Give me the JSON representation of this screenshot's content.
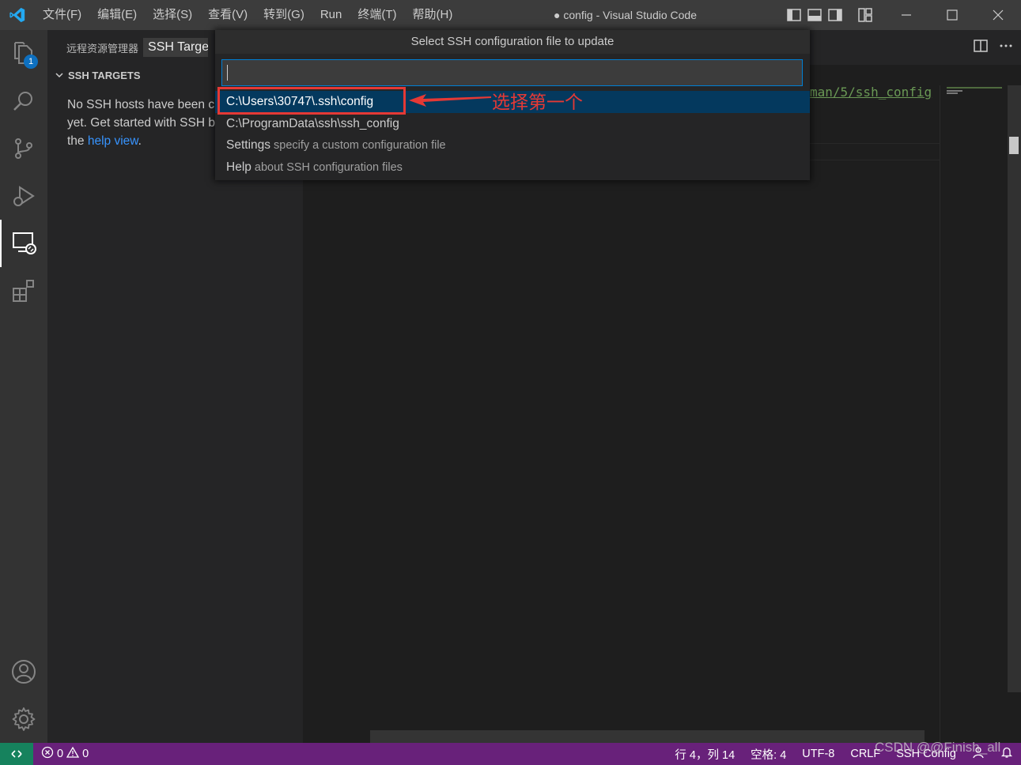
{
  "titlebar": {
    "menu": [
      "文件(F)",
      "编辑(E)",
      "选择(S)",
      "查看(V)",
      "转到(G)",
      "Run",
      "终端(T)",
      "帮助(H)"
    ],
    "window_title": "● config - Visual Studio Code"
  },
  "activitybar": {
    "explorer_badge": "1"
  },
  "sidebar": {
    "title": "远程资源管理器",
    "target_select": "SSH Targets",
    "section_title": "SSH TARGETS",
    "empty_line1": "No SSH hosts have been c",
    "empty_line2": "yet. Get started with SSH b",
    "empty_line3_prefix": "the ",
    "empty_link": "help view",
    "empty_line3_suffix": "."
  },
  "editor": {
    "code_fragment": "man/5/ssh_config"
  },
  "quickpick": {
    "title": "Select SSH configuration file to update",
    "input_value": "",
    "items": [
      {
        "label": "C:\\Users\\30747\\.ssh\\config",
        "description": ""
      },
      {
        "label": "C:\\ProgramData\\ssh\\ssh_config",
        "description": ""
      },
      {
        "label": "Settings",
        "description": "specify a custom configuration file"
      },
      {
        "label": "Help",
        "description": "about SSH configuration files"
      }
    ]
  },
  "annotation": {
    "text": "选择第一个",
    "color": "#e53935"
  },
  "statusbar": {
    "errors": "0",
    "warnings": "0",
    "position": "行 4，列 14",
    "indent": "空格: 4",
    "encoding": "UTF-8",
    "eol": "CRLF",
    "language": "SSH Config",
    "watermark": "CSDN @@Finish_all"
  },
  "colors": {
    "accent": "#007acc",
    "statusbar": "#68217a",
    "remote": "#16825d",
    "selection": "#04395e"
  }
}
